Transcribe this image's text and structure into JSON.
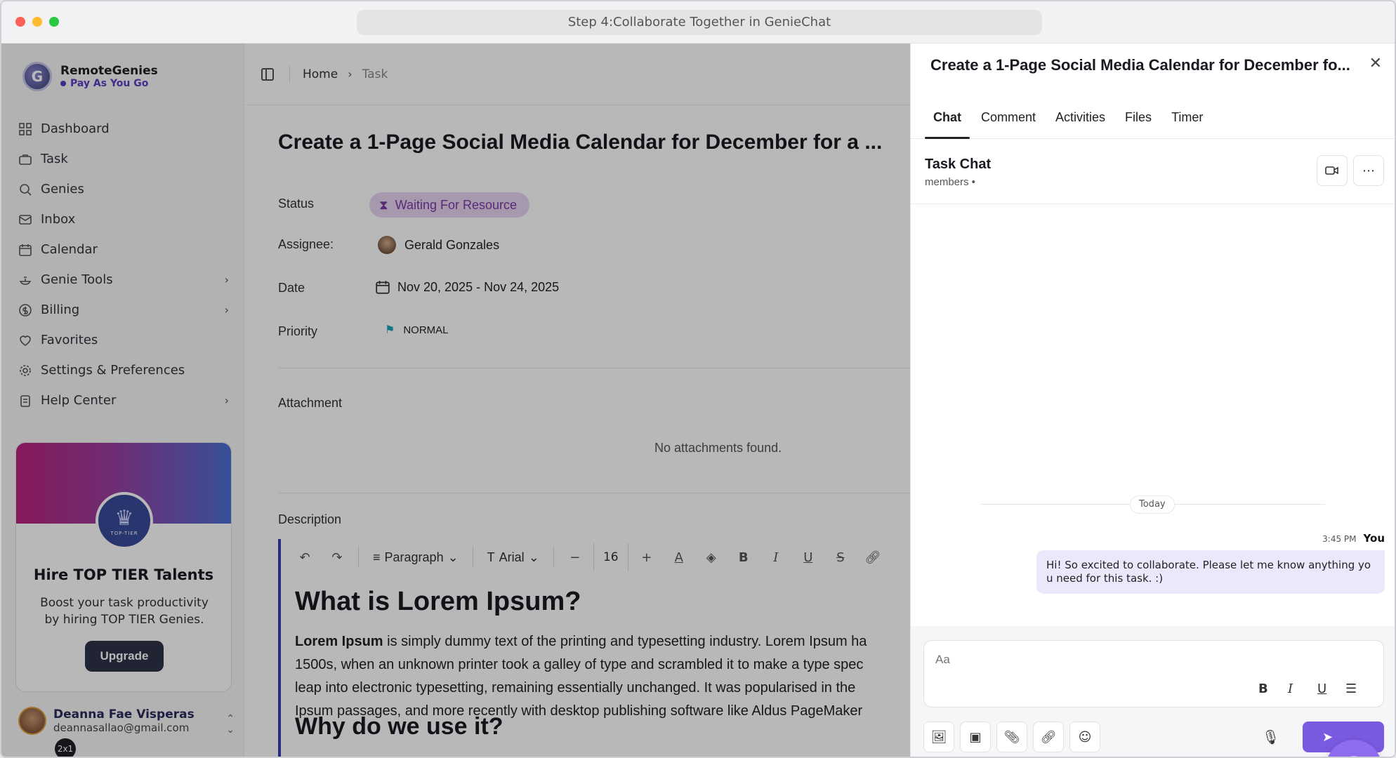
{
  "window": {
    "title": "Step 4:Collaborate Together in GenieChat"
  },
  "brand": {
    "name": "RemoteGenies",
    "plan": "Pay As You Go"
  },
  "nav": [
    {
      "label": "Dashboard",
      "icon": "grid-icon",
      "chevron": false
    },
    {
      "label": "Task",
      "icon": "briefcase-icon",
      "chevron": false
    },
    {
      "label": "Genies",
      "icon": "search-icon",
      "chevron": false
    },
    {
      "label": "Inbox",
      "icon": "mail-icon",
      "chevron": false
    },
    {
      "label": "Calendar",
      "icon": "calendar-icon",
      "chevron": false
    },
    {
      "label": "Genie Tools",
      "icon": "lamp-icon",
      "chevron": true
    },
    {
      "label": "Billing",
      "icon": "currency-icon",
      "chevron": true
    },
    {
      "label": "Favorites",
      "icon": "heart-icon",
      "chevron": false
    },
    {
      "label": "Settings & Preferences",
      "icon": "gear-icon",
      "chevron": false
    },
    {
      "label": "Help Center",
      "icon": "clipboard-icon",
      "chevron": true
    }
  ],
  "promo": {
    "badge": "TOP-TIER",
    "title": "Hire TOP TIER Talents",
    "description": "Boost your task productivity by hiring TOP TIER Genies.",
    "button": "Upgrade"
  },
  "user": {
    "name": "Deanna Fae Visperas",
    "email": "deannasallao@gmail.com"
  },
  "zoom_badge": "2x1",
  "breadcrumb": {
    "home": "Home",
    "current": "Task"
  },
  "task": {
    "title": "Create a 1-Page Social Media Calendar for December for a ...",
    "status_label": "Status",
    "status": "Waiting For Resource",
    "assignee_label": "Assignee:",
    "assignee": "Gerald Gonzales",
    "date_label": "Date",
    "date": "Nov 20, 2025 - Nov 24, 2025",
    "priority_label": "Priority",
    "priority": "NORMAL",
    "attachment_label": "Attachment",
    "no_attachments": "No attachments found.",
    "description_label": "Description"
  },
  "editor": {
    "block_type": "Paragraph",
    "font": "Arial",
    "font_size": "16",
    "heading1": "What is Lorem Ipsum?",
    "paragraph_bold": "Lorem Ipsum",
    "paragraph_lines": [
      " is simply dummy text of the printing and typesetting industry. Lorem Ipsum ha",
      "1500s, when an unknown printer took a galley of type and scrambled it to make a type spec",
      "leap into electronic typesetting, remaining essentially unchanged. It was popularised in the",
      "Ipsum passages, and more recently with desktop publishing software like Aldus PageMaker"
    ],
    "heading2": "Why do we use it?"
  },
  "panel": {
    "title": "Create a 1-Page Social Media Calendar for December fo...",
    "tabs": [
      "Chat",
      "Comment",
      "Activities",
      "Files",
      "Timer"
    ],
    "active_tab": "Chat",
    "chat_title": "Task Chat",
    "chat_subtitle": "members •",
    "day_divider": "Today",
    "message": {
      "time": "3:45 PM",
      "author": "You",
      "text": "Hi! So excited to collaborate. Please let me know anything you need for this task. :)"
    },
    "composer_placeholder": "Aa"
  },
  "colors": {
    "accent": "#7a5ae0",
    "status_bg": "#e6d4f2",
    "status_fg": "#7a3aa6",
    "priority_flag": "#1aa3b8",
    "editor_bar": "#3b3bb3"
  }
}
